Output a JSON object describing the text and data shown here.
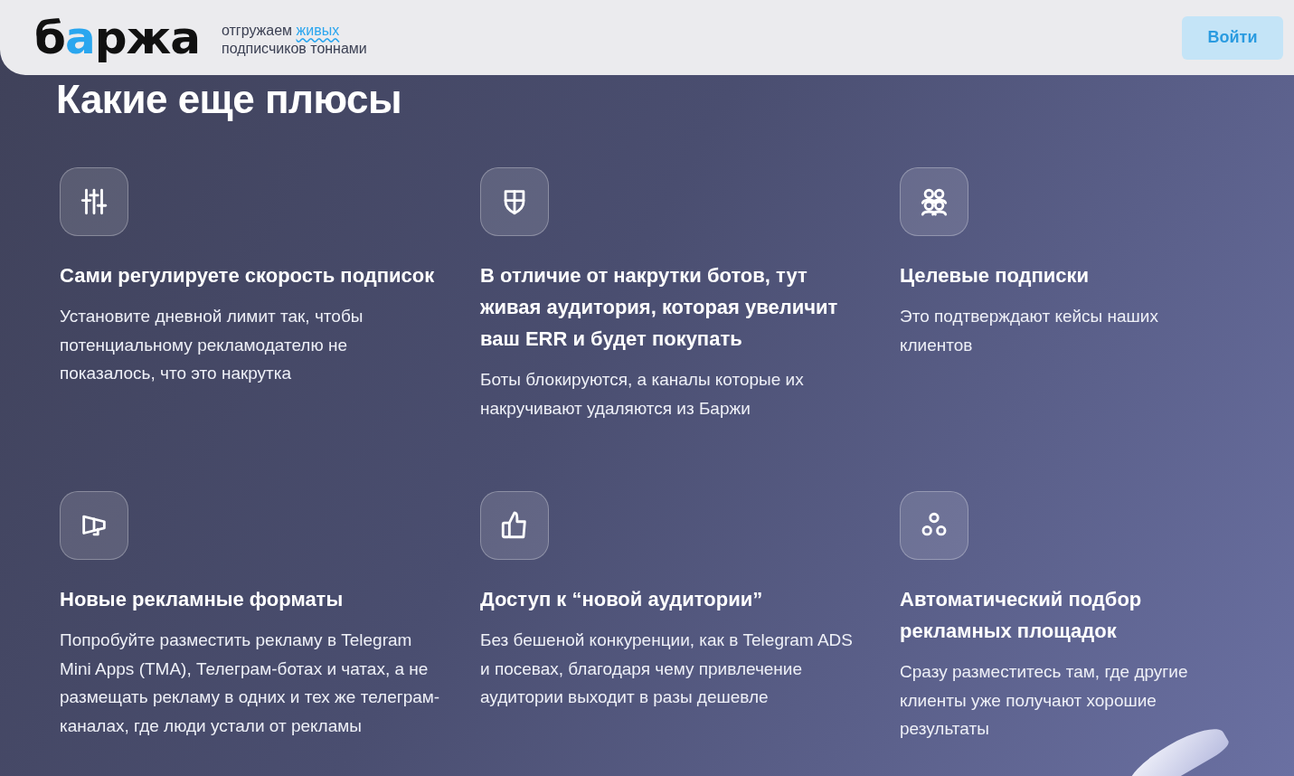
{
  "header": {
    "logo": {
      "before": "б",
      "accent": "а",
      "after": "ржа"
    },
    "tagline": {
      "start": "отгружаем",
      "highlight": "живых",
      "line2": "подписчиков тоннами"
    },
    "login_button": "Войти"
  },
  "section_title": "Какие еще плюсы",
  "features": [
    {
      "title": "Сами регулируете скорость подписок",
      "text": "Установите дневной лимит так, чтобы потенциальному рекламодателю не показалось, что это накрутка"
    },
    {
      "title": "В отличие от накрутки ботов, тут живая аудитория, которая увеличит ваш ERR и будет покупать",
      "text": "Боты блокируются, а каналы которые их накручивают удаляются из Баржи"
    },
    {
      "title": "Целевые подписки",
      "text": "Это подтверждают кейсы наших клиентов"
    },
    {
      "title": "Новые рекламные форматы",
      "text": "Попробуйте разместить рекламу в Telegram Mini Apps (TMA), Телеграм-ботах и чатах, а не размещать рекламу в одних и тех же телеграм-каналах, где люди устали от рекламы"
    },
    {
      "title": "Доступ к “новой аудитории”",
      "text": "Без бешеной конкуренции, как в Telegram ADS и посевах, благодаря чему привлечение аудитории выходит в разы дешевле"
    },
    {
      "title": "Автоматический подбор рекламных площадок",
      "text": "Сразу разместитесь там, где другие клиенты уже получают хорошие результаты"
    }
  ]
}
